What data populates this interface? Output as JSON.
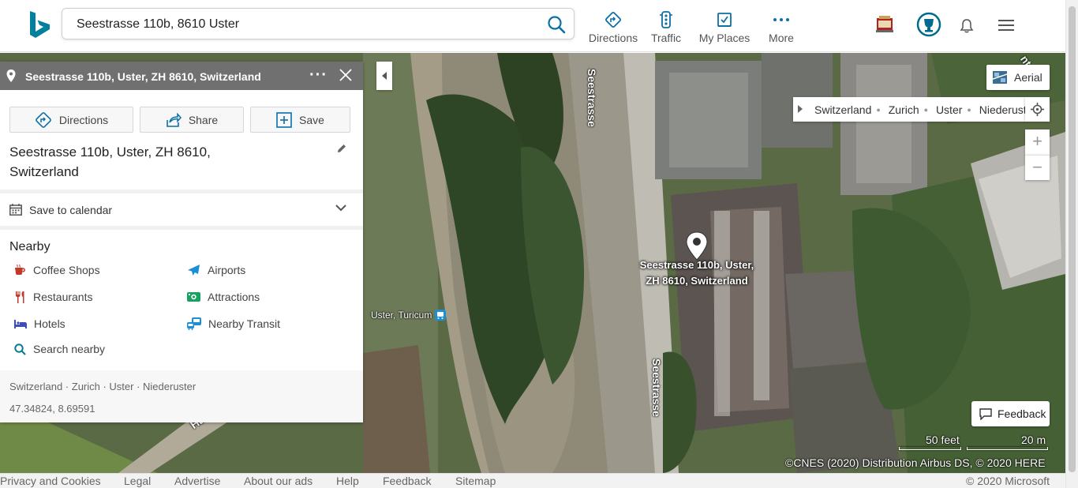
{
  "header": {
    "search_value": "Seestrasse 110b, 8610 Uster",
    "nav": [
      "Directions",
      "Traffic",
      "My Places",
      "More"
    ]
  },
  "panel": {
    "title": "Seestrasse 110b, Uster, ZH 8610, Switzerland",
    "actions": [
      "Directions",
      "Share",
      "Save"
    ],
    "place_name_line1": "Seestrasse 110b, Uster, ZH 8610,",
    "place_name_line2": "Switzerland",
    "calendar_label": "Save to calendar",
    "nearby_title": "Nearby",
    "nearby": {
      "coffee": "Coffee Shops",
      "airports": "Airports",
      "restaurants": "Restaurants",
      "attractions": "Attractions",
      "hotels": "Hotels",
      "transit": "Nearby Transit",
      "search": "Search nearby"
    },
    "breadcrumb": "Switzerland · Zurich · Uster · Niederuster",
    "coords": "47.34824, 8.69591"
  },
  "map": {
    "style_button": "Aerial",
    "crumbs": [
      "Switzerland",
      "Zurich",
      "Uster",
      "Niederuster"
    ],
    "zoom_in": "+",
    "zoom_out": "−",
    "pin_label_line1": "Seestrasse 110b, Uster,",
    "pin_label_line2": "ZH 8610, Switzerland",
    "street_top": "Seestrasse",
    "street_bottom": "Seestrasse",
    "street_left": "Ha",
    "transit_stop": "Uster, Turicum",
    "feedback": "Feedback",
    "scale_feet": "50 feet",
    "scale_m": "20 m",
    "copyright": "©CNES (2020) Distribution Airbus DS, © 2020 HERE"
  },
  "footer": {
    "links": [
      "Privacy and Cookies",
      "Legal",
      "Advertise",
      "About our ads",
      "Help",
      "Feedback",
      "Sitemap"
    ],
    "copyright": "© 2020 Microsoft"
  },
  "colors": {
    "accent": "#0b6fa8",
    "panel_header": "#707070"
  }
}
